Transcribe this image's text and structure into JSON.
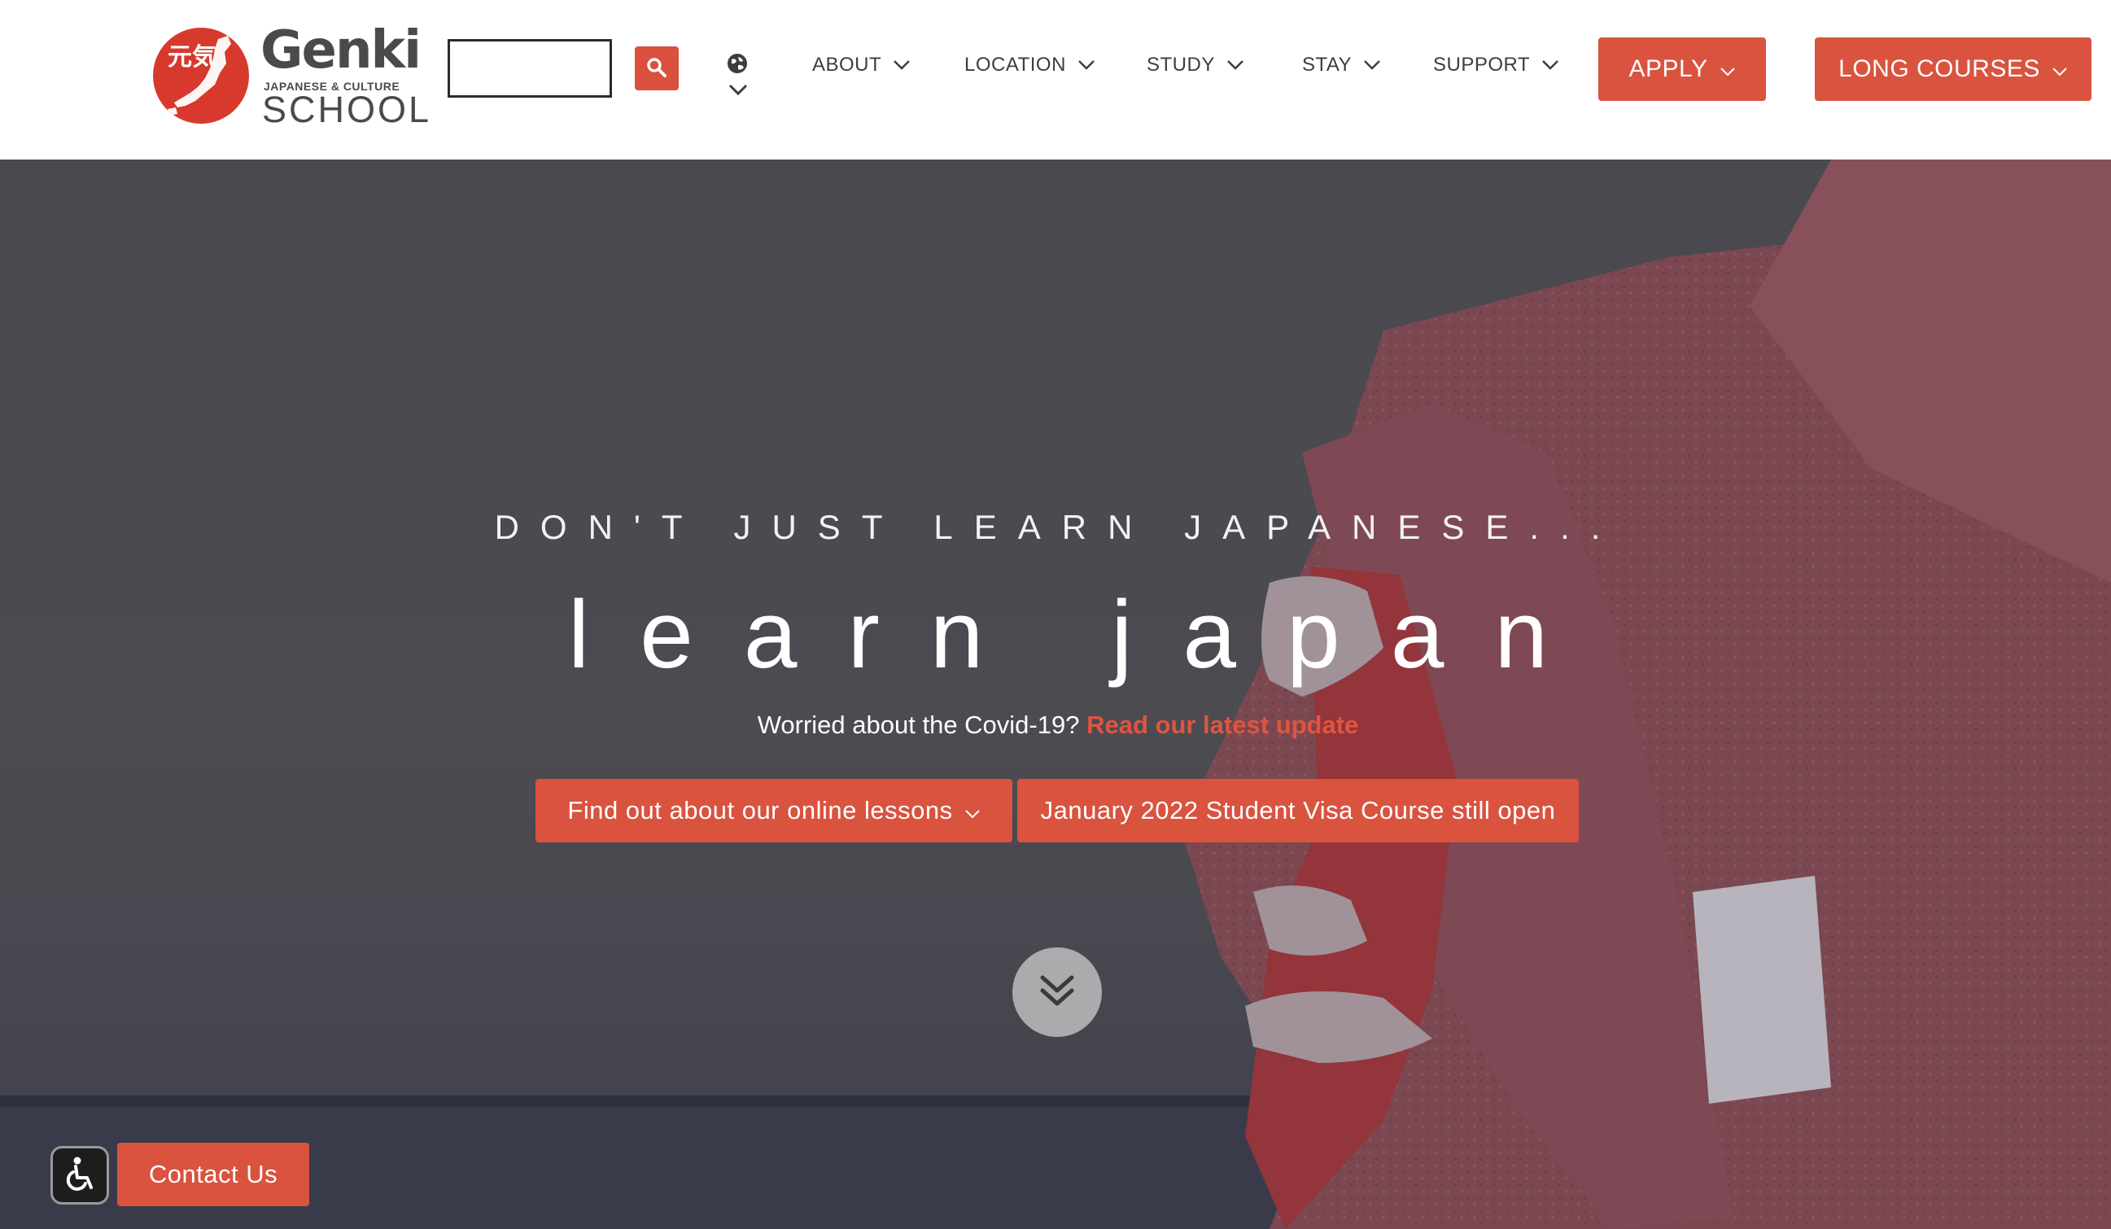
{
  "header": {
    "logo": {
      "wordmark": "Genki",
      "kanji": "元気",
      "subtitle": "JAPANESE & CULTURE",
      "school": "SCHOOL"
    },
    "search": {
      "value": "",
      "placeholder": ""
    },
    "nav": [
      {
        "label": "ABOUT"
      },
      {
        "label": "LOCATION"
      },
      {
        "label": "STUDY"
      },
      {
        "label": "STAY"
      },
      {
        "label": "SUPPORT"
      }
    ],
    "apply_label": "APPLY",
    "long_courses_label": "LONG COURSES"
  },
  "hero": {
    "eyebrow": "DON'T JUST LEARN JAPANESE...",
    "headline": "learn japan",
    "covid_text": "Worried about the Covid-19?",
    "covid_link": "Read our latest update",
    "cta_online": "Find out about our online lessons",
    "cta_visa": "January 2022 Student Visa Course still open"
  },
  "footer_widgets": {
    "contact_label": "Contact Us"
  },
  "colors": {
    "accent": "#d9533f",
    "link": "#e0553f",
    "hero_overlay": "#505055",
    "kimono": "#8a4a52"
  },
  "icons": [
    "search-icon",
    "globe-icon",
    "chevron-down-icon",
    "double-chevron-down-icon",
    "accessibility-icon"
  ]
}
